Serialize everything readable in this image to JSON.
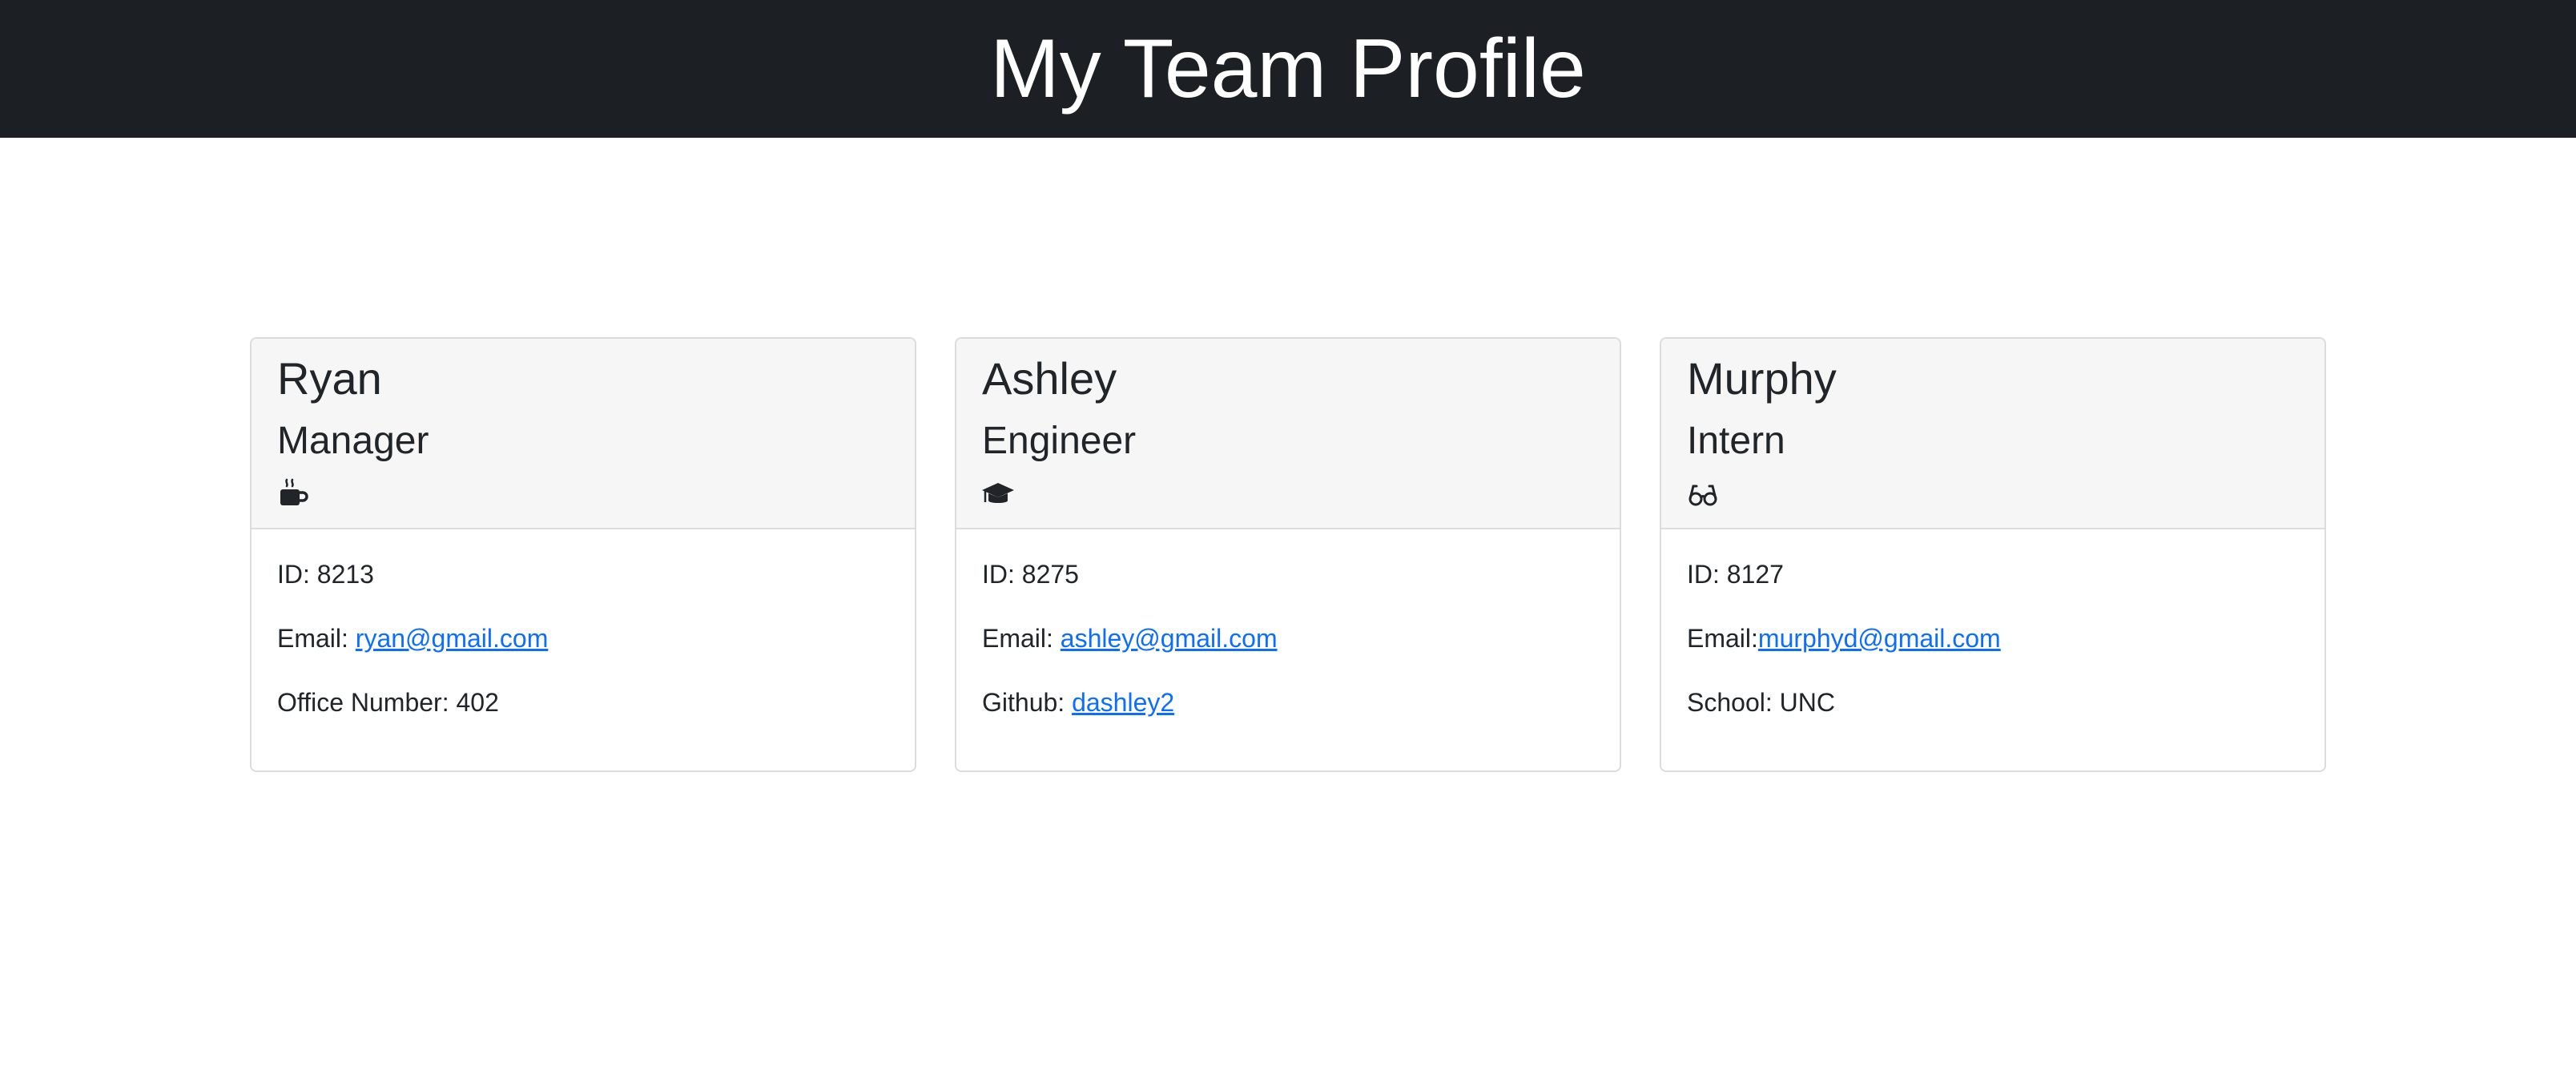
{
  "header": {
    "title": "My Team Profile"
  },
  "colors": {
    "header_bg": "#1c2024",
    "card_header_bg": "#f6f6f6",
    "link": "#0d6efd"
  },
  "cards": [
    {
      "name": "Ryan",
      "role": "Manager",
      "icon": "coffee-mug-icon",
      "id_label": "ID: ",
      "id_value": "8213",
      "email_label": "Email: ",
      "email_value": "ryan@gmail.com",
      "extra_label": "Office Number: ",
      "extra_value": "402"
    },
    {
      "name": "Ashley",
      "role": "Engineer",
      "icon": "graduation-cap-icon",
      "id_label": "ID: ",
      "id_value": "8275",
      "email_label": "Email: ",
      "email_value": "ashley@gmail.com",
      "extra_label": "Github: ",
      "extra_value": "dashley2"
    },
    {
      "name": "Murphy",
      "role": "Intern",
      "icon": "glasses-icon",
      "id_label": "ID: ",
      "id_value": "8127",
      "email_label": "Email:",
      "email_value": "murphyd@gmail.com",
      "extra_label": "School: ",
      "extra_value": "UNC"
    }
  ]
}
